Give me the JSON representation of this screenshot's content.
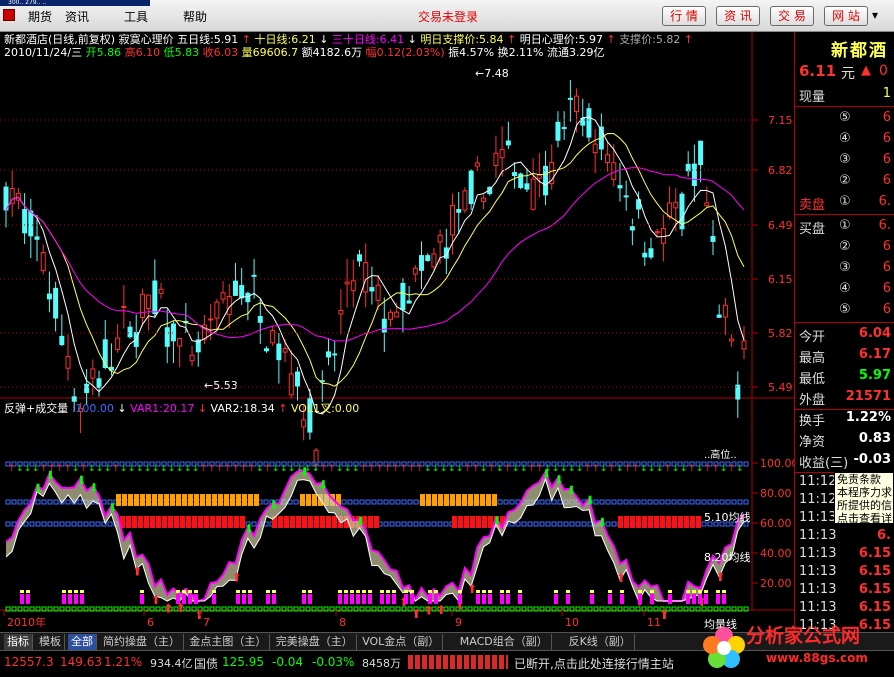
{
  "window": {
    "title": "300.. 279.. .."
  },
  "menu": [
    "期货",
    "资讯",
    "工具",
    "帮助"
  ],
  "trade_status": "交易未登录",
  "top_buttons": [
    "行 情",
    "资 讯",
    "交 易",
    "网 站"
  ],
  "colors": {
    "red": "#ff3030",
    "cyan": "#54fcfc",
    "yellow": "#ffff54",
    "magenta": "#ff00ff",
    "green": "#00ff00",
    "orange": "#ff9f00",
    "blue": "#3a6cff"
  },
  "main": {
    "title_segments": [
      {
        "text": "新都酒店(日线,前复权) 寂寞心理价",
        "color": "#ffffff"
      },
      {
        "text": "五日线:5.91",
        "color": "#ffffff"
      },
      {
        "text": "↑",
        "color": "#ff3030"
      },
      {
        "text": "十日线:6.21",
        "color": "#ffff54"
      },
      {
        "text": "↓",
        "color": "#ffffff"
      },
      {
        "text": "三十日线:6.41",
        "color": "#ff00ff"
      },
      {
        "text": "↓",
        "color": "#ffffff"
      },
      {
        "text": "明日支撑价:5.84",
        "color": "#ffff54"
      },
      {
        "text": "↑",
        "color": "#ff3030"
      },
      {
        "text": "明日心理价:5.97",
        "color": "#ffffff"
      },
      {
        "text": "↑",
        "color": "#ff3030"
      },
      {
        "text": "支撑价:5.82",
        "color": "#aaaaaa"
      },
      {
        "text": "↑",
        "color": "#ff3030"
      }
    ],
    "info_segments": [
      {
        "text": "2010/11/24/三",
        "color": "#ffffff"
      },
      {
        "text": "开5.86",
        "color": "#00ff00"
      },
      {
        "text": "高6.10",
        "color": "#ff3030"
      },
      {
        "text": "低5.83",
        "color": "#00ff00"
      },
      {
        "text": "收6.03",
        "color": "#ff3030"
      },
      {
        "text": "量69606.7",
        "color": "#ffff54"
      },
      {
        "text": "额4182.6万",
        "color": "#ffffff"
      },
      {
        "text": "幅0.12(2.03%)",
        "color": "#ff3030"
      },
      {
        "text": "振4.57% 换2.11% 流通3.29亿",
        "color": "#ffffff"
      }
    ],
    "price_ticks": [
      "7.15",
      "6.82",
      "6.49",
      "6.15",
      "5.82",
      "5.49"
    ],
    "high_label": "7.48",
    "low_label": "5.53"
  },
  "indicator": {
    "title_segments": [
      {
        "text": "反弹+成交量",
        "color": "#ffffff"
      },
      {
        "text": ":100.00",
        "color": "#3a6cff"
      },
      {
        "text": "↓",
        "color": "#ffffff"
      },
      {
        "text": "VAR1:20.17",
        "color": "#ff00ff"
      },
      {
        "text": "↓",
        "color": "#ff3030"
      },
      {
        "text": "VAR2:18.34",
        "color": "#ffffff"
      },
      {
        "text": "↑",
        "color": "#ff3030"
      },
      {
        "text": "VOL1叉:0.00",
        "color": "#ffff54"
      }
    ],
    "ticks": [
      "100.00",
      "80.00",
      "60.00",
      "40.00",
      "20.00"
    ],
    "line_labels": [
      "5.10均线",
      "8.20均线",
      "均量线"
    ],
    "top_right_label": "..高位.."
  },
  "x_axis": {
    "labels": [
      "2010年",
      "6",
      "7",
      "8",
      "9",
      "10",
      "11"
    ]
  },
  "quote": {
    "name": "新都酒",
    "price": "6.11",
    "unit": "元",
    "arrow": "▲",
    "change": "0",
    "now_vol_label": "现量",
    "now_vol_value": "1",
    "sell_label": "卖盘",
    "buy_label": "买盘",
    "sell_rows": [
      {
        "n": "⑤",
        "v": "6"
      },
      {
        "n": "④",
        "v": "6"
      },
      {
        "n": "③",
        "v": "6"
      },
      {
        "n": "②",
        "v": "6"
      },
      {
        "n": "①",
        "v": "6."
      }
    ],
    "buy_rows": [
      {
        "n": "①",
        "v": "6."
      },
      {
        "n": "②",
        "v": "6"
      },
      {
        "n": "③",
        "v": "6"
      },
      {
        "n": "④",
        "v": "6"
      },
      {
        "n": "⑤",
        "v": "6"
      }
    ],
    "stats": [
      {
        "label": "今开",
        "value": "6.04",
        "color": "#ff3030"
      },
      {
        "label": "最高",
        "value": "6.17",
        "color": "#ff3030"
      },
      {
        "label": "最低",
        "value": "5.97",
        "color": "#00ff00"
      },
      {
        "label": "外盘",
        "value": "21571",
        "color": "#ff3030"
      },
      {
        "label": "换手",
        "value": "1.22%",
        "color": "#ffffff"
      },
      {
        "label": "净资",
        "value": "0.83",
        "color": "#ffffff"
      },
      {
        "label": "收益(三)",
        "value": "-0.03",
        "color": "#ffffff"
      }
    ],
    "ticks": [
      {
        "time": "11:12",
        "value": "6.11"
      },
      {
        "time": "11:12",
        "value": "6."
      },
      {
        "time": "11:13",
        "value": "6."
      },
      {
        "time": "11:13",
        "value": "6."
      },
      {
        "time": "11:13",
        "value": "6.15"
      },
      {
        "time": "11:13",
        "value": "6.15"
      },
      {
        "time": "11:13",
        "value": "6.15"
      },
      {
        "time": "11:13",
        "value": "6.15"
      },
      {
        "time": "11:13",
        "value": "6.15"
      }
    ]
  },
  "tooltip": {
    "lines": [
      "免责条款",
      "本程序力求",
      "所提供的信",
      "点击查看详"
    ]
  },
  "tabs": [
    "指标",
    "模板",
    "全部",
    "简约操盘（主）",
    "金点主图（主）",
    "完美操盘（主）",
    "VOL金点（副）",
    "MACD组合（副）",
    "反K线（副）"
  ],
  "status": {
    "index1": "12557.3",
    "index1_chg": "149.63",
    "index1_pct": "1.21%",
    "index1_amt": "934.4亿",
    "bond_label": "国债",
    "bond_value": "125.95",
    "bond_chg": "-0.04",
    "bond_pct": "-0.03%",
    "bond_amt": "8458万",
    "conn": "已断开,点击此处连接行情主站"
  },
  "brand": {
    "name": "分析家公式网",
    "url": "www.88gs.com"
  }
}
